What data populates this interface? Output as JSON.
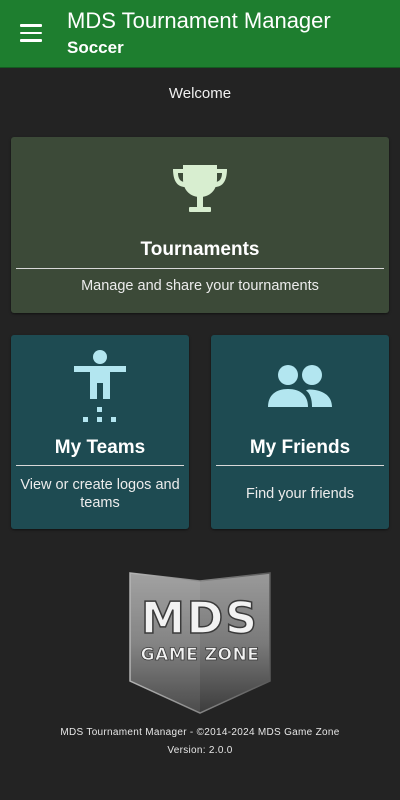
{
  "appbar": {
    "title": "MDS Tournament Manager",
    "subtitle": "Soccer",
    "menu_icon": "hamburger-menu-icon",
    "color": "#1e7e2f"
  },
  "welcome": "Welcome",
  "cards": {
    "tournaments": {
      "icon": "trophy-icon",
      "title": "Tournaments",
      "description": "Manage and share your tournaments",
      "color": "#3c4a38"
    },
    "teams": {
      "icon": "person-figure-icon",
      "title": "My Teams",
      "description": "View or create logos and teams",
      "color": "#1e4b52"
    },
    "friends": {
      "icon": "people-icon",
      "title": "My Friends",
      "description": "Find your friends",
      "color": "#1e4b52"
    }
  },
  "logo": {
    "line1": "MDS",
    "line2": "GAME ZONE"
  },
  "footer": {
    "copyright": "MDS Tournament Manager - ©2014-2024 MDS Game Zone",
    "version": "Version: 2.0.0"
  },
  "colors": {
    "background": "#232323",
    "icon_tint": "#d8eed0",
    "icon_tint_teal": "#b3e6f0"
  }
}
